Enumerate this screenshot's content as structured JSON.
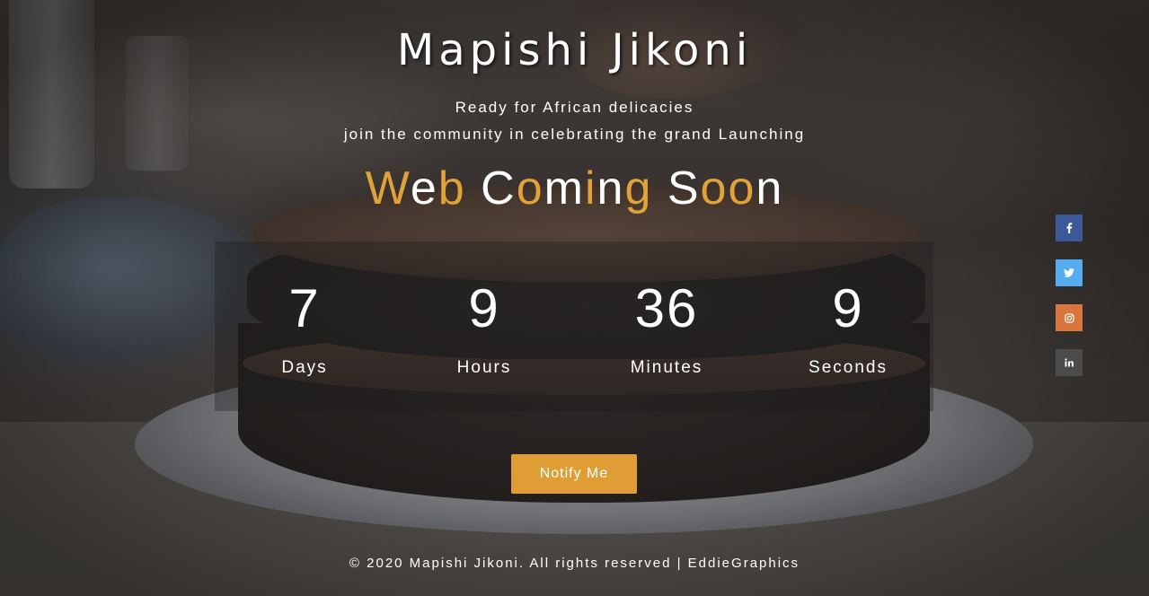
{
  "brand": {
    "name": "Mapishi Jikoni"
  },
  "hero": {
    "tagline_line1": "Ready for African delicacies",
    "tagline_line2": "join the community in celebrating the grand Launching",
    "headline_letters": [
      {
        "ch": "W",
        "color": "#e1a239"
      },
      {
        "ch": "e",
        "color": "#ffffff"
      },
      {
        "ch": "b",
        "color": "#e1a239"
      },
      {
        "ch": " ",
        "color": "#ffffff"
      },
      {
        "ch": "C",
        "color": "#ffffff"
      },
      {
        "ch": "o",
        "color": "#e1a239"
      },
      {
        "ch": "m",
        "color": "#ffffff"
      },
      {
        "ch": "i",
        "color": "#e1a239"
      },
      {
        "ch": "n",
        "color": "#ffffff"
      },
      {
        "ch": "g",
        "color": "#e1a239"
      },
      {
        "ch": " ",
        "color": "#ffffff"
      },
      {
        "ch": "S",
        "color": "#ffffff"
      },
      {
        "ch": "o",
        "color": "#e1a239"
      },
      {
        "ch": "o",
        "color": "#e1a239"
      },
      {
        "ch": "n",
        "color": "#ffffff"
      }
    ]
  },
  "countdown": {
    "days": {
      "value": "7",
      "label": "Days"
    },
    "hours": {
      "value": "9",
      "label": "Hours"
    },
    "minutes": {
      "value": "36",
      "label": "Minutes"
    },
    "seconds": {
      "value": "9",
      "label": "Seconds"
    }
  },
  "cta": {
    "notify_label": "Notify Me"
  },
  "social": {
    "facebook": {
      "icon": "facebook-icon",
      "color": "#3b5998"
    },
    "twitter": {
      "icon": "twitter-icon",
      "color": "#55acee"
    },
    "instagram": {
      "icon": "instagram-icon",
      "color": "#d9763e"
    },
    "linkedin": {
      "icon": "linkedin-icon",
      "color": "#4b4b4b"
    }
  },
  "footer": {
    "text": "© 2020 Mapishi Jikoni. All rights reserved | EddieGraphics"
  },
  "colors": {
    "accent": "#e09d35",
    "text": "#ffffff"
  }
}
